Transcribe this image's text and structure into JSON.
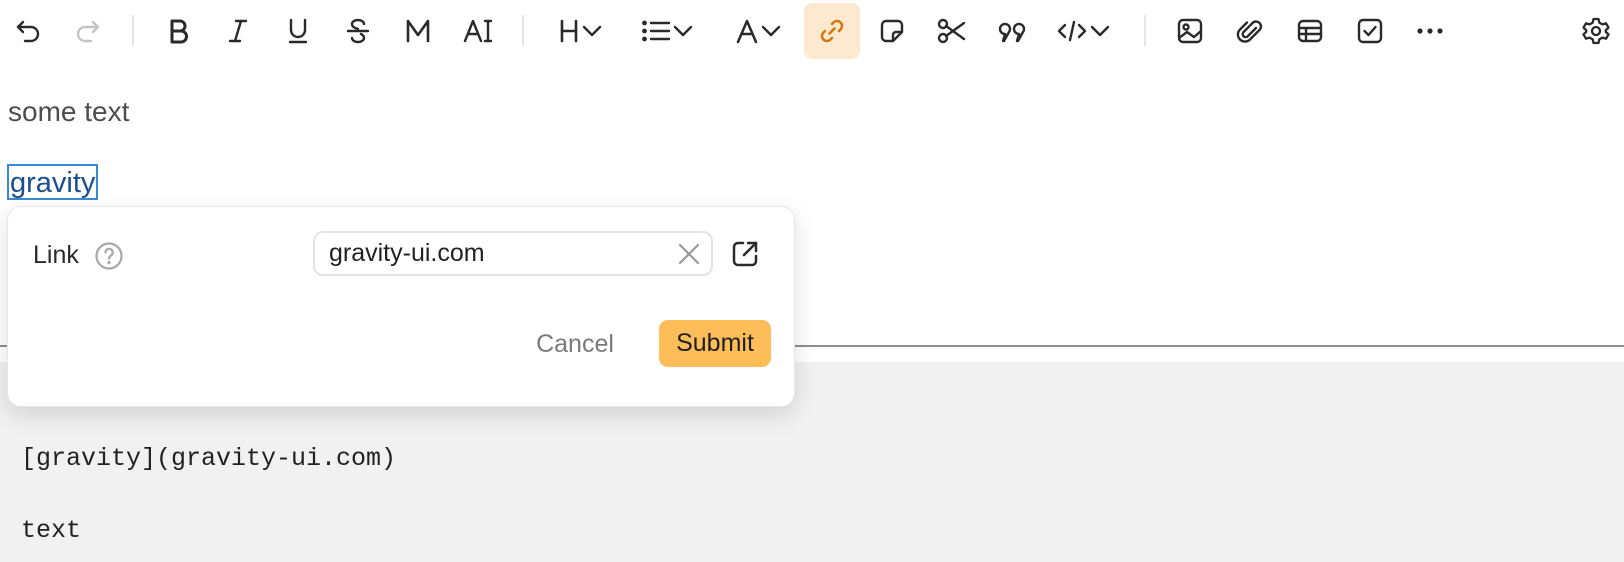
{
  "toolbar": {
    "icons": [
      "undo-icon",
      "redo-icon",
      "bold-icon",
      "italic-icon",
      "underline-icon",
      "strikethrough-icon",
      "monospace-icon",
      "text-color-icon",
      "heading-icon",
      "list-icon",
      "text-style-icon",
      "link-icon",
      "note-icon",
      "cut-icon",
      "quote-icon",
      "code-icon",
      "image-icon",
      "attachment-icon",
      "table-icon",
      "checkbox-icon",
      "more-icon",
      "settings-icon"
    ],
    "active_item": "link",
    "accent": "#d4770f"
  },
  "editor": {
    "line1": "some text",
    "link_text": "gravity"
  },
  "link_popup": {
    "label": "Link",
    "url_value": "gravity-ui.com",
    "cancel_label": "Cancel",
    "submit_label": "Submit",
    "submit_color": "#fdbd58"
  },
  "markup": {
    "line1": "[gravity](gravity-ui.com)",
    "line2": "text"
  }
}
